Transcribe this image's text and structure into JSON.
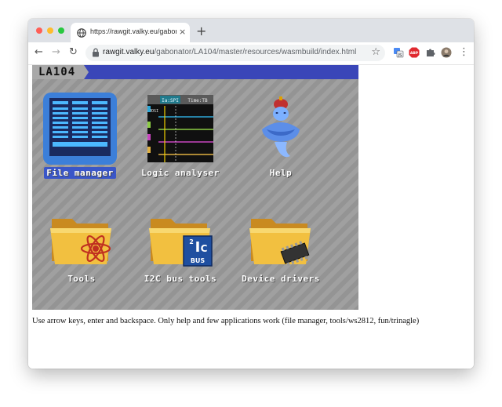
{
  "browser": {
    "tab": {
      "title": "https://rawgit.valky.eu/gabonator",
      "close_glyph": "×"
    },
    "new_tab_glyph": "+",
    "nav": {
      "back": "←",
      "forward": "→",
      "reload": "↻"
    },
    "omnibox": {
      "host": "rawgit.valky.eu",
      "path": "/gabonator/LA104/master/resources/wasmbuild/index.html",
      "bookmark_glyph": "☆"
    },
    "extensions": [
      "translate-extension-icon",
      "adblock-icon",
      "extensions-puzzle-icon",
      "profile-avatar"
    ],
    "menu_glyph": "⋮"
  },
  "emulator": {
    "title": "LA104",
    "bar_color": "#3a46b8",
    "selection_color": "#3a56c8",
    "apps": [
      {
        "label": "File manager",
        "icon": "file-manager-icon",
        "selected": true
      },
      {
        "label": "Logic analyser",
        "icon": "logic-analyser-icon",
        "selected": false
      },
      {
        "label": "Help",
        "icon": "genie-lamp-icon",
        "selected": false
      },
      {
        "label": "Tools",
        "icon": "folder-atom-icon",
        "selected": false
      },
      {
        "label": "I2C bus tools",
        "icon": "folder-i2c-icon",
        "selected": false
      },
      {
        "label": "Device drivers",
        "icon": "folder-chip-icon",
        "selected": false
      }
    ],
    "logic_preview": {
      "tab1": "Ia:SPI",
      "tab2": "Time:TB",
      "channel": "MOSI"
    },
    "i2c_text": "BUS"
  },
  "instructions": "Use arrow keys, enter and backspace. Only help and few applications work (file manager, tools/ws2812, fun/trinagle)"
}
